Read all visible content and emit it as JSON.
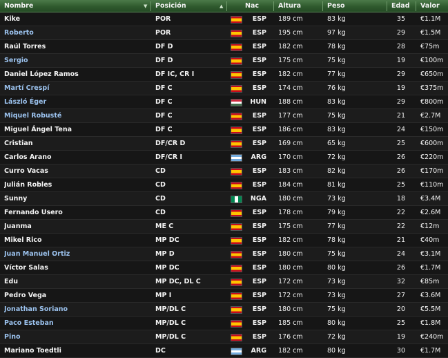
{
  "columns": {
    "nombre": "Nombre",
    "posicion": "Posición",
    "nac": "Nac",
    "altura": "Altura",
    "peso": "Peso",
    "edad": "Edad",
    "valor": "Valor"
  },
  "icons": {
    "nombre_sort": "chevron-down-icon",
    "posicion_sort": "sort-ascending-icon"
  },
  "colors": {
    "header_bg": "#2f5a2e",
    "on_loan_name": "#9cc3ef",
    "text": "#f4f4f4"
  },
  "players": [
    {
      "name": "Kike",
      "pos": "POR",
      "nac": "ESP",
      "altura": "189 cm",
      "peso": "83 kg",
      "edad": "35",
      "valor": "€1.1M",
      "highlight": false
    },
    {
      "name": "Roberto",
      "pos": "POR",
      "nac": "ESP",
      "altura": "195 cm",
      "peso": "97 kg",
      "edad": "29",
      "valor": "€1.5M",
      "highlight": true
    },
    {
      "name": "Raúl Torres",
      "pos": "DF D",
      "nac": "ESP",
      "altura": "182 cm",
      "peso": "78 kg",
      "edad": "28",
      "valor": "€75m",
      "highlight": false
    },
    {
      "name": "Sergio",
      "pos": "DF D",
      "nac": "ESP",
      "altura": "175 cm",
      "peso": "75 kg",
      "edad": "19",
      "valor": "€100m",
      "highlight": true
    },
    {
      "name": "Daniel López Ramos",
      "pos": "DF IC, CR I",
      "nac": "ESP",
      "altura": "182 cm",
      "peso": "77 kg",
      "edad": "29",
      "valor": "€650m",
      "highlight": false
    },
    {
      "name": "Martí Crespí",
      "pos": "DF C",
      "nac": "ESP",
      "altura": "174 cm",
      "peso": "76 kg",
      "edad": "19",
      "valor": "€375m",
      "highlight": true
    },
    {
      "name": "László Éger",
      "pos": "DF C",
      "nac": "HUN",
      "altura": "188 cm",
      "peso": "83 kg",
      "edad": "29",
      "valor": "€800m",
      "highlight": true
    },
    {
      "name": "Miquel Robusté",
      "pos": "DF C",
      "nac": "ESP",
      "altura": "177 cm",
      "peso": "75 kg",
      "edad": "21",
      "valor": "€2.7M",
      "highlight": true
    },
    {
      "name": "Miguel Ángel Tena",
      "pos": "DF C",
      "nac": "ESP",
      "altura": "186 cm",
      "peso": "83 kg",
      "edad": "24",
      "valor": "€150m",
      "highlight": false
    },
    {
      "name": "Cristian",
      "pos": "DF/CR D",
      "nac": "ESP",
      "altura": "169 cm",
      "peso": "65 kg",
      "edad": "25",
      "valor": "€600m",
      "highlight": false
    },
    {
      "name": "Carlos Arano",
      "pos": "DF/CR I",
      "nac": "ARG",
      "altura": "170 cm",
      "peso": "72 kg",
      "edad": "26",
      "valor": "€220m",
      "highlight": false
    },
    {
      "name": "Curro Vacas",
      "pos": "CD",
      "nac": "ESP",
      "altura": "183 cm",
      "peso": "82 kg",
      "edad": "26",
      "valor": "€170m",
      "highlight": false
    },
    {
      "name": "Julián Robles",
      "pos": "CD",
      "nac": "ESP",
      "altura": "184 cm",
      "peso": "81 kg",
      "edad": "25",
      "valor": "€110m",
      "highlight": false
    },
    {
      "name": "Sunny",
      "pos": "CD",
      "nac": "NGA",
      "altura": "180 cm",
      "peso": "73 kg",
      "edad": "18",
      "valor": "€3.4M",
      "highlight": false
    },
    {
      "name": "Fernando Usero",
      "pos": "CD",
      "nac": "ESP",
      "altura": "178 cm",
      "peso": "79 kg",
      "edad": "22",
      "valor": "€2.6M",
      "highlight": false
    },
    {
      "name": "Juanma",
      "pos": "ME C",
      "nac": "ESP",
      "altura": "175 cm",
      "peso": "77 kg",
      "edad": "22",
      "valor": "€12m",
      "highlight": false
    },
    {
      "name": "Mikel Rico",
      "pos": "MP DC",
      "nac": "ESP",
      "altura": "182 cm",
      "peso": "78 kg",
      "edad": "21",
      "valor": "€40m",
      "highlight": false
    },
    {
      "name": "Juan Manuel Ortiz",
      "pos": "MP D",
      "nac": "ESP",
      "altura": "180 cm",
      "peso": "75 kg",
      "edad": "24",
      "valor": "€3.1M",
      "highlight": true
    },
    {
      "name": "Víctor Salas",
      "pos": "MP DC",
      "nac": "ESP",
      "altura": "180 cm",
      "peso": "80 kg",
      "edad": "26",
      "valor": "€1.7M",
      "highlight": false
    },
    {
      "name": "Edu",
      "pos": "MP DC, DL C",
      "nac": "ESP",
      "altura": "172 cm",
      "peso": "73 kg",
      "edad": "32",
      "valor": "€85m",
      "highlight": false
    },
    {
      "name": "Pedro Vega",
      "pos": "MP I",
      "nac": "ESP",
      "altura": "172 cm",
      "peso": "73 kg",
      "edad": "27",
      "valor": "€3.6M",
      "highlight": false
    },
    {
      "name": "Jonathan Soriano",
      "pos": "MP/DL C",
      "nac": "ESP",
      "altura": "180 cm",
      "peso": "75 kg",
      "edad": "20",
      "valor": "€5.5M",
      "highlight": true
    },
    {
      "name": "Paco Esteban",
      "pos": "MP/DL C",
      "nac": "ESP",
      "altura": "185 cm",
      "peso": "80 kg",
      "edad": "25",
      "valor": "€1.8M",
      "highlight": true
    },
    {
      "name": "Pino",
      "pos": "MP/DL C",
      "nac": "ESP",
      "altura": "176 cm",
      "peso": "72 kg",
      "edad": "19",
      "valor": "€240m",
      "highlight": true
    },
    {
      "name": "Mariano Toedtli",
      "pos": "DC",
      "nac": "ARG",
      "altura": "182 cm",
      "peso": "80 kg",
      "edad": "30",
      "valor": "€1.7M",
      "highlight": false
    }
  ]
}
